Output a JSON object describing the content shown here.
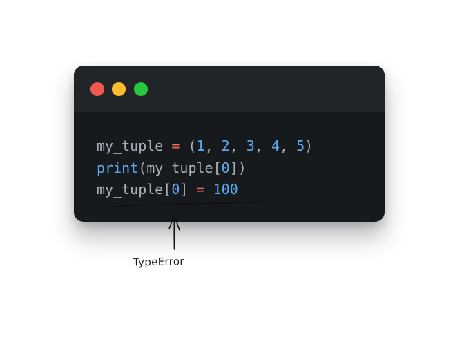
{
  "window": {
    "controls": [
      {
        "name": "close",
        "color": "#f1584f"
      },
      {
        "name": "minimize",
        "color": "#fdbb2e"
      },
      {
        "name": "maximize",
        "color": "#27c73e"
      }
    ],
    "colors": {
      "body": "#171a1c",
      "titlebar": "#222527"
    }
  },
  "code": {
    "line1": {
      "var": "my_tuple",
      "assign": "=",
      "open": "(",
      "n1": "1",
      "c1": ",",
      "n2": "2",
      "c2": ",",
      "n3": "3",
      "c3": ",",
      "n4": "4",
      "c4": ",",
      "n5": "5",
      "close": ")"
    },
    "line2": {
      "fn": "print",
      "open": "(",
      "var": "my_tuple",
      "bopen": "[",
      "idx": "0",
      "bclose": "]",
      "close": ")"
    },
    "line3": {
      "var": "my_tuple",
      "bopen": "[",
      "idx": "0",
      "bclose": "]",
      "assign": "=",
      "value": "100"
    },
    "colors": {
      "text": "#a8b0b8",
      "operator": "#ec6f5d",
      "number": "#5fa8ef",
      "function": "#5fa8ef"
    }
  },
  "annotation": {
    "label": "TypeError"
  }
}
